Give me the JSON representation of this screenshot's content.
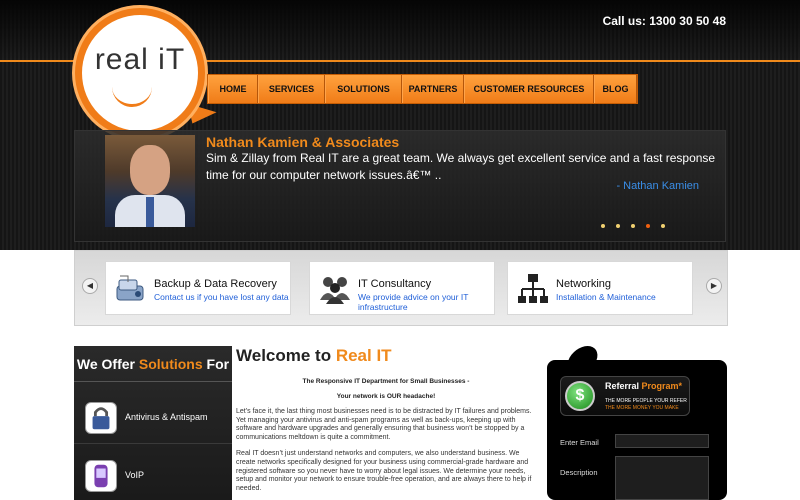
{
  "header": {
    "call_us": "Call us: 1300 30 50 48",
    "logo_text": "real iT"
  },
  "nav": {
    "items": [
      "HOME",
      "SERVICES",
      "SOLUTIONS",
      "PARTNERS",
      "CUSTOMER RESOURCES",
      "BLOG"
    ]
  },
  "testimonial": {
    "name": "Nathan Kamien & Associates",
    "quote": "Sim & Zillay from Real IT are a great team. We always get excellent service and a fast response time for our computer network issues.â€™ ..",
    "author": "- Nathan Kamien",
    "slide_count": 5,
    "active_slide": 4
  },
  "services": {
    "prev_icon": "left-arrow",
    "next_icon": "right-arrow",
    "items": [
      {
        "title": "Backup & Data Recovery",
        "subtitle": "Contact us if you have lost any data",
        "icon": "backup-drive-icon"
      },
      {
        "title": "IT Consultancy",
        "subtitle": "We provide advice on your IT infrastructure",
        "icon": "people-icon"
      },
      {
        "title": "Networking",
        "subtitle": "Installation & Maintenance",
        "icon": "network-icon"
      }
    ]
  },
  "solutions": {
    "head_prefix": "We Offer ",
    "head_accent": "Solutions",
    "head_suffix": " For",
    "items": [
      {
        "label": "Antivirus & Antispam",
        "icon": "padlock-icon"
      },
      {
        "label": "VoIP",
        "icon": "phone-icon"
      }
    ]
  },
  "main": {
    "welcome_prefix": "Welcome to ",
    "welcome_accent": "Real IT",
    "tagline": "The Responsive IT Department for Small Businesses -",
    "tagline2": "Your network is OUR headache!",
    "para1": "Let’s face it, the last thing most businesses need is to be distracted by IT failures and problems. Yet managing your antivirus and anti-spam programs as well as back-ups, keeping up with software and hardware upgrades and generally ensuring that business won’t be stopped by a communications meltdown is quite a commitment.",
    "para2": "Real IT doesn’t just understand networks and computers, we also understand business. We create networks specifically designed for your business using commercial-grade hardware and registered software so you never have to worry about legal issues. We determine your needs, setup and monitor your network to ensure trouble-free operation, and are always there to help if needed."
  },
  "referral": {
    "title_prefix": "Referral ",
    "title_accent": "Program*",
    "line1": "THE MORE PEOPLE YOUR REFER",
    "line2": "THE MORE MONEY YOU MAKE",
    "icon_glyph": "$",
    "email_label": "Enter Email",
    "description_label": "Description"
  },
  "colors": {
    "accent": "#f08a1c",
    "link_blue": "#1f5fd8",
    "header_bg": "#1a1a1a"
  }
}
